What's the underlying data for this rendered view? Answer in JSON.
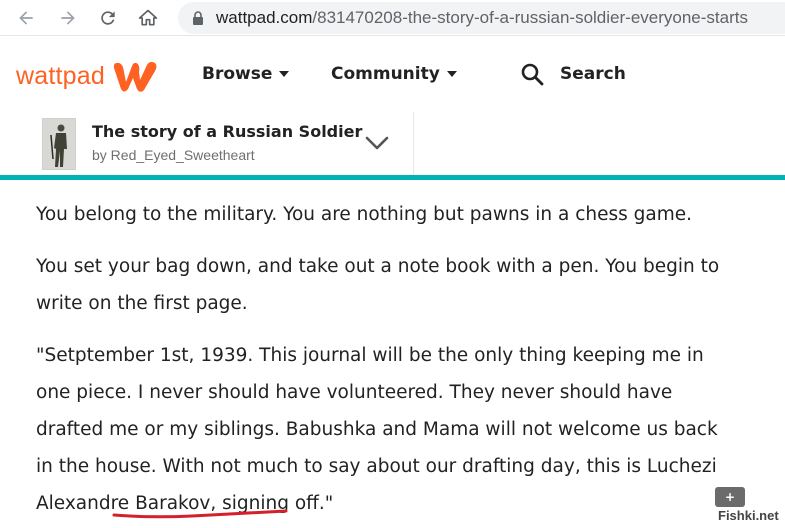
{
  "browser": {
    "url_host": "wattpad.com",
    "url_path": "/831470208-the-story-of-a-russian-soldier-everyone-starts",
    "icons": [
      "back-icon",
      "forward-icon",
      "reload-icon",
      "home-icon",
      "lock-icon"
    ]
  },
  "header": {
    "logo_text": "wattpad",
    "brand_color": "#ff6122",
    "menu": [
      {
        "label": "Browse"
      },
      {
        "label": "Community"
      }
    ],
    "search_label": "Search"
  },
  "story_bar": {
    "title": "The story of a Russian Soldier",
    "author": "by Red_Eyed_Sweetheart",
    "accent_color": "#00b2b2"
  },
  "story": {
    "paragraphs": [
      "You belong to the military. You are nothing but pawns in a chess game.",
      "You set your bag down, and take out a note book with a pen. You begin to write on the first page.",
      "\"Setptember 1st, 1939. This journal will be the only thing keeping me in one piece. I never should have volunteered. They never should have drafted me or my siblings. Babushka and Mama will not welcome us back in the house. With not much to say about our drafting day, this is Luchezi Alexandre Barakov, signing off.\""
    ]
  },
  "widgets": {
    "plus_label": "+",
    "watermark": "Fishki.net"
  }
}
